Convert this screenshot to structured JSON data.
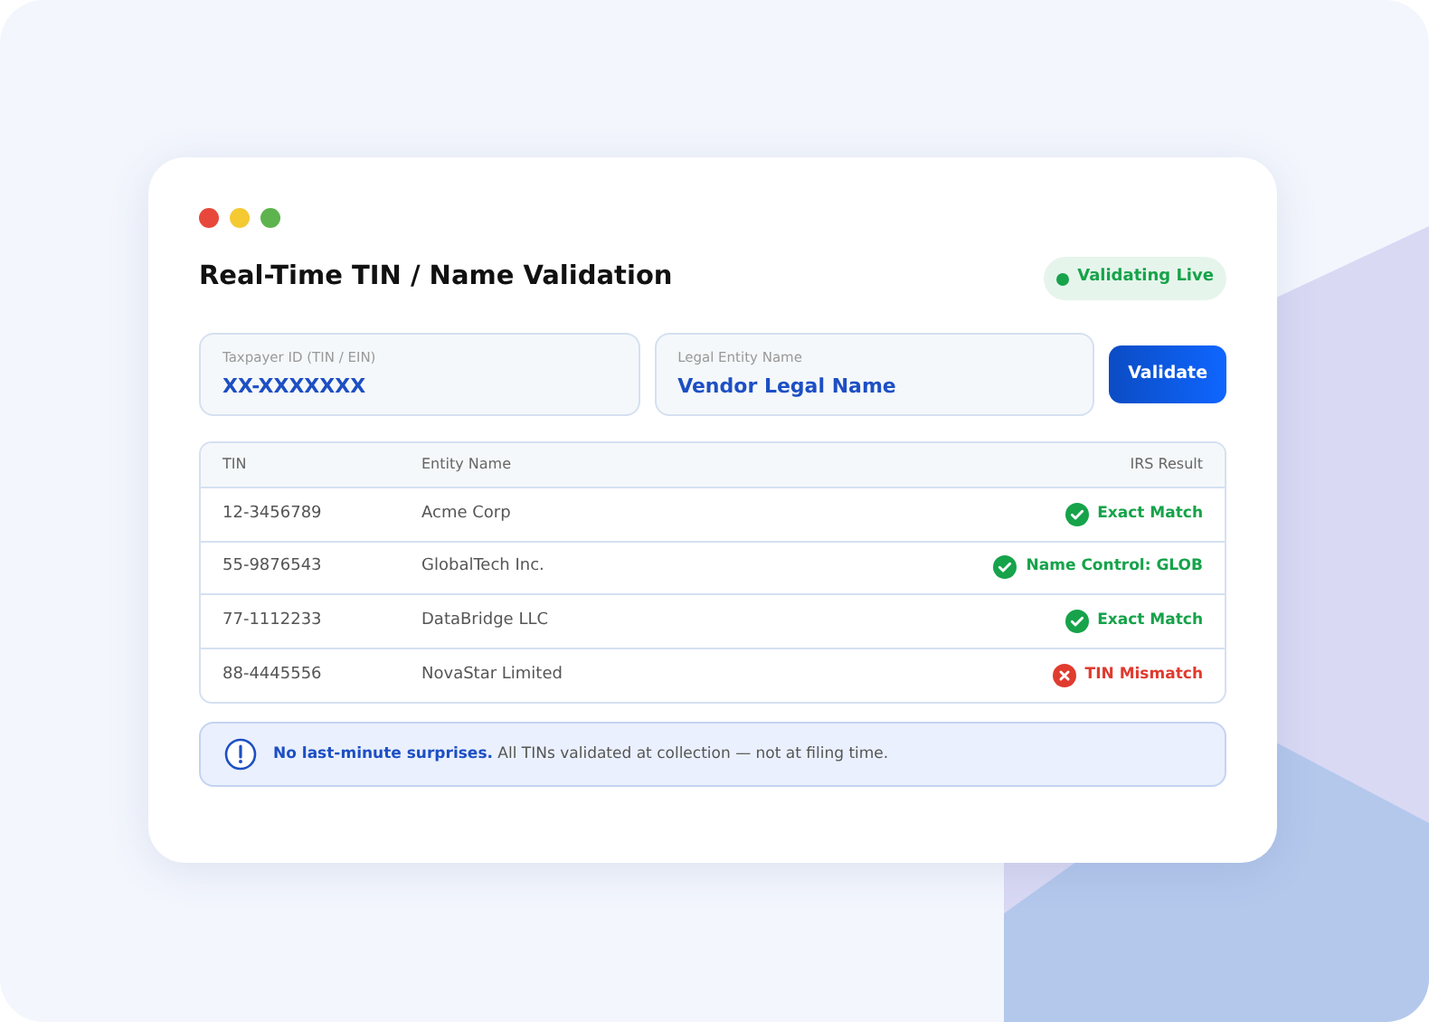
{
  "window": {
    "title": "Real-Time TIN / Name Validation"
  },
  "status_badge": "Validating Live",
  "fields": [
    {
      "label": "Taxpayer ID (TIN / EIN)",
      "value": "XX-XXXXXXX"
    },
    {
      "label": "Legal Entity Name",
      "value": "Vendor Legal Name"
    }
  ],
  "validate_button": "Validate",
  "table": {
    "columns": [
      "TIN",
      "Entity Name",
      "IRS Result"
    ],
    "rows": [
      {
        "tin": "12-3456789",
        "name": "Acme Corp",
        "result": "Exact Match",
        "kind": "match"
      },
      {
        "tin": "55-9876543",
        "name": "GlobalTech Inc.",
        "result": "Name Control: GLOB",
        "kind": "match"
      },
      {
        "tin": "77-1112233",
        "name": "DataBridge LLC",
        "result": "Exact Match",
        "kind": "match"
      },
      {
        "tin": "88-4445556",
        "name": "NovaStar Limited",
        "result": "TIN Mismatch",
        "kind": "mismatch"
      }
    ]
  },
  "notice": "**No last-minute surprises.** All TINs validated at collection — not at filing time."
}
